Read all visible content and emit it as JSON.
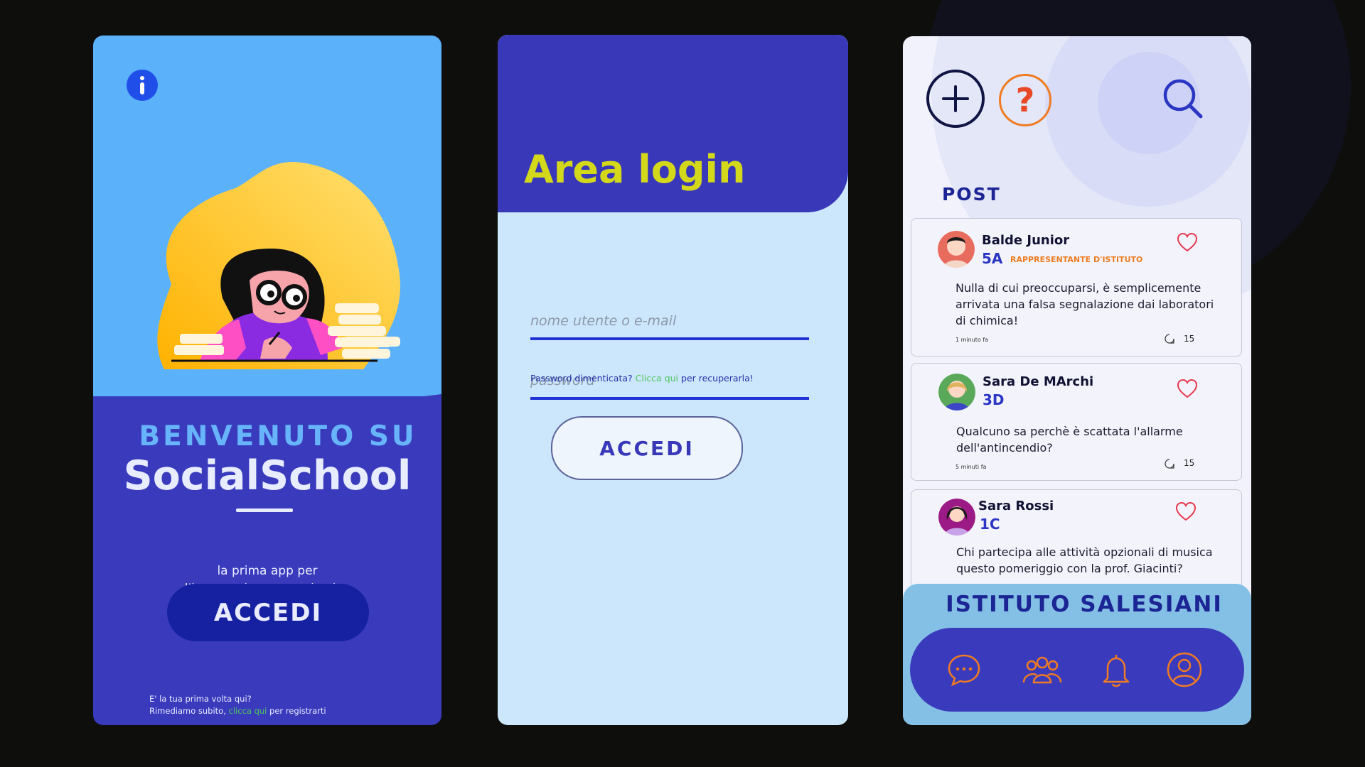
{
  "phone1": {
    "welcome": "BENVENUTO SU",
    "app_name": "SocialSchool",
    "tagline_line1": "la prima app per",
    "tagline_line2": "l'intrattenimento scolastico",
    "button": "ACCEDI",
    "first_time": "E' la tua prima volta qui?",
    "fix_prefix": "Rimediamo subito, ",
    "fix_link": "clicca qui",
    "fix_suffix": " per registrarti"
  },
  "phone2": {
    "title": "Area login",
    "username_placeholder": "nome utente o e-mail",
    "password_placeholder": "password",
    "forgot_prefix": "Password dimenticata? ",
    "forgot_link": "Clicca qui",
    "forgot_suffix": " per recuperarla!",
    "button": "ACCEDI"
  },
  "phone3": {
    "section_title": "POST",
    "posts": [
      {
        "name": "Balde Junior",
        "class": "5A",
        "role": "RAPPRESENTANTE D'ISTITUTO",
        "text": "Nulla di cui preoccuparsi, è semplicemente arrivata una falsa segnalazione dai laboratori di chimica!",
        "time": "1 minuto fa",
        "comments": "15"
      },
      {
        "name": "Sara De MArchi",
        "class": "3D",
        "text": "Qualcuno sa perchè è scattata l'allarme dell'antincendio?",
        "time": "5 minuti fa",
        "comments": "15"
      },
      {
        "name": "Sara Rossi",
        "class": "1C",
        "text": "Chi partecipa alle attività opzionali di musica questo pomeriggio con la prof. Giacinti?"
      }
    ],
    "school_name": "ISTITUTO SALESIANI",
    "nav_icons": [
      "chat-icon",
      "group-icon",
      "bell-icon",
      "profile-icon"
    ]
  },
  "colors": {
    "dark_blue": "#3a3bbc",
    "light_blue": "#5cb1fb",
    "login_bg": "#cce6fb",
    "title_yellow": "#d4d81a",
    "accent_orange": "#f07b21",
    "heart_red": "#e8384f",
    "link_green": "#4fc75d"
  }
}
